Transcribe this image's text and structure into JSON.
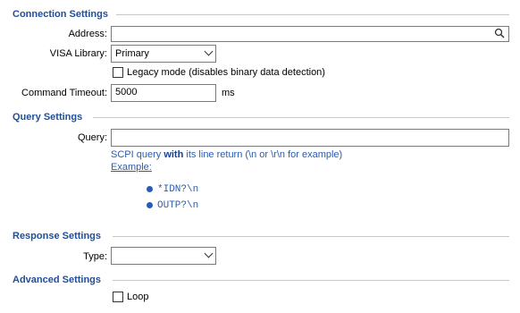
{
  "connection": {
    "title": "Connection Settings",
    "address_label": "Address:",
    "address_value": "",
    "visa_label": "VISA Library:",
    "visa_value": "Primary",
    "legacy_label": "Legacy mode (disables binary data detection)",
    "legacy_checked": false,
    "timeout_label": "Command Timeout:",
    "timeout_value": "5000",
    "timeout_unit": "ms"
  },
  "query": {
    "title": "Query Settings",
    "query_label": "Query:",
    "query_value": "",
    "help_pre": "SCPI query ",
    "help_bold": "with",
    "help_post": " its line return (\\n or \\r\\n for example)",
    "example_label": "Example:",
    "examples": [
      "*IDN?\\n",
      "OUTP?\\n"
    ]
  },
  "response": {
    "title": "Response Settings",
    "type_label": "Type:",
    "type_value": ""
  },
  "advanced": {
    "title": "Advanced Settings",
    "loop_label": "Loop",
    "loop_checked": false
  },
  "icons": {
    "search": "search-icon",
    "dropdown": "chevron-down-icon"
  },
  "colors": {
    "section_title": "#1f4e9a",
    "help_text": "#2a5db0"
  }
}
